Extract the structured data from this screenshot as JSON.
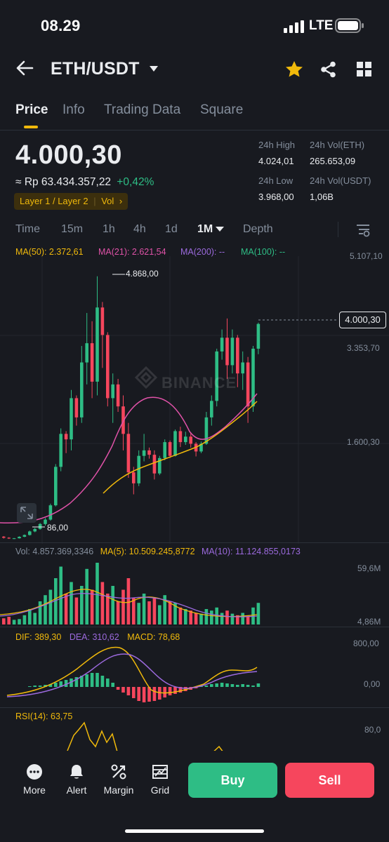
{
  "status_bar": {
    "time": "08.29",
    "network": "LTE"
  },
  "header": {
    "pair": "ETH/USDT"
  },
  "tabs": [
    {
      "label": "Price"
    },
    {
      "label": "Info"
    },
    {
      "label": "Trading Data"
    },
    {
      "label": "Square"
    }
  ],
  "price": {
    "last": "4.000,30",
    "idr": "≈ Rp 63.434.357,22",
    "change": "+0,42%",
    "tags": "Layer 1 / Layer 2",
    "tag_vol": "Vol"
  },
  "stats": {
    "high_label": "24h High",
    "high": "4.024,01",
    "vol_eth_label": "24h Vol(ETH)",
    "vol_eth": "265.653,09",
    "low_label": "24h Low",
    "low": "3.968,00",
    "vol_usdt_label": "24h Vol(USDT)",
    "vol_usdt": "1,06B"
  },
  "intervals": [
    {
      "label": "Time"
    },
    {
      "label": "15m"
    },
    {
      "label": "1h"
    },
    {
      "label": "4h"
    },
    {
      "label": "1d"
    },
    {
      "label": "1M"
    },
    {
      "label": "Depth"
    }
  ],
  "ma_legend": {
    "ma50": "MA(50): 2.372,61",
    "ma21": "MA(21): 2.621,54",
    "ma200": "MA(200): --",
    "ma100": "MA(100): --"
  },
  "colors": {
    "up": "#2ebd85",
    "down": "#f6465d",
    "accent": "#f0b90b",
    "ma50": "#f0b90b",
    "ma21": "#e052a8",
    "ma200": "#9c6ade",
    "ma100": "#2ebd85"
  },
  "price_axis": {
    "top": "5.107,10",
    "mid1": "3.353,70",
    "mid2": "1.600,30",
    "current": "4.000,30",
    "high_marker": "4.868,00",
    "low_marker": "86,00"
  },
  "watermark": "BINANCE",
  "volume": {
    "legend_vol": "Vol: 4.857.369,3346",
    "legend_ma5": "MA(5): 10.509.245,8772",
    "legend_ma10": "MA(10): 11.124.855,0173",
    "axis_top": "59,6M",
    "axis_bottom": "4,86M"
  },
  "macd": {
    "dif": "DIF: 389,30",
    "dea": "DEA: 310,62",
    "macd": "MACD: 78,68",
    "axis_top": "800,00",
    "axis_zero": "0,00"
  },
  "rsi": {
    "label": "RSI(14): 63,75",
    "axis_top": "80,0"
  },
  "bottom_nav": [
    {
      "label": "More",
      "icon": "more-icon"
    },
    {
      "label": "Alert",
      "icon": "bell-icon"
    },
    {
      "label": "Margin",
      "icon": "margin-icon"
    },
    {
      "label": "Grid",
      "icon": "grid-bot-icon"
    }
  ],
  "actions": {
    "buy": "Buy",
    "sell": "Sell"
  },
  "chart_data": {
    "type": "candlestick",
    "interval": "1M",
    "ohlc_approx": [
      [
        130,
        140,
        95,
        110
      ],
      [
        110,
        120,
        88,
        96
      ],
      [
        96,
        106,
        86,
        100
      ],
      [
        100,
        135,
        96,
        128
      ],
      [
        128,
        170,
        120,
        160
      ],
      [
        160,
        240,
        150,
        225
      ],
      [
        225,
        290,
        210,
        270
      ],
      [
        270,
        380,
        255,
        360
      ],
      [
        360,
        470,
        330,
        440
      ],
      [
        440,
        730,
        420,
        700
      ],
      [
        700,
        1450,
        680,
        1400
      ],
      [
        1400,
        2100,
        1320,
        2000
      ],
      [
        2000,
        2050,
        1650,
        1900
      ],
      [
        1900,
        2800,
        1700,
        2650
      ],
      [
        2650,
        2700,
        2150,
        2300
      ],
      [
        2300,
        3600,
        2200,
        3300
      ],
      [
        3300,
        4200,
        2900,
        3650
      ],
      [
        3650,
        4050,
        2650,
        2950
      ],
      [
        2950,
        4868,
        2700,
        4300
      ],
      [
        4300,
        4400,
        3200,
        3800
      ],
      [
        3800,
        3850,
        2500,
        2650
      ],
      [
        2650,
        3100,
        2200,
        2900
      ],
      [
        2900,
        3000,
        2400,
        2500
      ],
      [
        2500,
        2700,
        1700,
        2000
      ],
      [
        2000,
        2200,
        1200,
        1300
      ],
      [
        1300,
        1400,
        900,
        1100
      ],
      [
        1100,
        1700,
        1050,
        1600
      ],
      [
        1600,
        2000,
        1500,
        1700
      ],
      [
        1700,
        1750,
        1550,
        1620
      ],
      [
        1620,
        1700,
        1170,
        1280
      ],
      [
        1280,
        1600,
        1250,
        1560
      ],
      [
        1560,
        1900,
        1520,
        1850
      ],
      [
        1850,
        1880,
        1560,
        1600
      ],
      [
        1600,
        2080,
        1590,
        2050
      ],
      [
        2050,
        2130,
        1760,
        1850
      ],
      [
        1850,
        2040,
        1800,
        1950
      ],
      [
        1950,
        2030,
        1750,
        1820
      ],
      [
        1820,
        1850,
        1590,
        1680
      ],
      [
        1680,
        1860,
        1650,
        1820
      ],
      [
        1820,
        2400,
        1800,
        2300
      ],
      [
        2300,
        2700,
        2150,
        2600
      ],
      [
        2600,
        3550,
        2500,
        3500
      ],
      [
        3500,
        3900,
        3350,
        3750
      ],
      [
        3750,
        4100,
        3000,
        3250
      ],
      [
        3250,
        3900,
        3100,
        3750
      ],
      [
        3750,
        3800,
        2850,
        3100
      ],
      [
        3100,
        3500,
        2800,
        3300
      ],
      [
        3300,
        3400,
        2200,
        2500
      ],
      [
        2500,
        3600,
        2400,
        3550
      ],
      [
        3550,
        4024,
        3450,
        4000.3
      ]
    ]
  }
}
